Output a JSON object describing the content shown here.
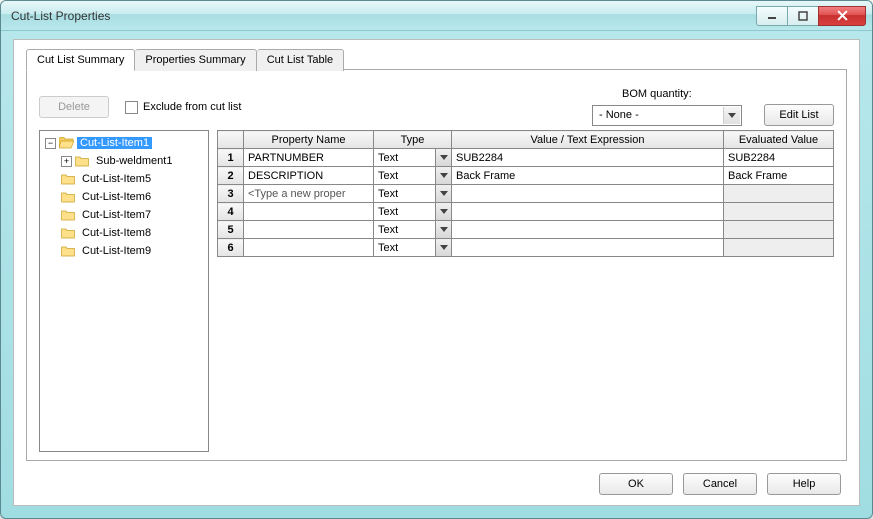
{
  "window": {
    "title": "Cut-List Properties"
  },
  "tabs": [
    {
      "label": "Cut List Summary",
      "active": true
    },
    {
      "label": "Properties Summary",
      "active": false
    },
    {
      "label": "Cut List Table",
      "active": false
    }
  ],
  "toolbar": {
    "delete_label": "Delete",
    "exclude_label": "Exclude from cut list",
    "bom_label": "BOM quantity:",
    "bom_value": "- None -",
    "edit_list_label": "Edit List"
  },
  "tree": {
    "root": {
      "label": "Cut-List-Item1",
      "selected": true,
      "open": true,
      "children": [
        {
          "label": "Sub-weldment1",
          "expandable": true
        }
      ]
    },
    "siblings": [
      {
        "label": "Cut-List-Item5"
      },
      {
        "label": "Cut-List-Item6"
      },
      {
        "label": "Cut-List-Item7"
      },
      {
        "label": "Cut-List-Item8"
      },
      {
        "label": "Cut-List-Item9"
      }
    ]
  },
  "grid": {
    "headers": {
      "propname": "Property Name",
      "type": "Type",
      "value": "Value / Text Expression",
      "evaluated": "Evaluated Value"
    },
    "type_default": "Text",
    "placeholder": "<Type a new proper",
    "rows": [
      {
        "n": "1",
        "name": "PARTNUMBER",
        "type": "Text",
        "value": "SUB2284",
        "evaluated": "SUB2284"
      },
      {
        "n": "2",
        "name": "DESCRIPTION",
        "type": "Text",
        "value": "Back Frame",
        "evaluated": "Back Frame"
      },
      {
        "n": "3",
        "name": "",
        "type": "Text",
        "value": "",
        "evaluated": ""
      },
      {
        "n": "4",
        "name": "",
        "type": "Text",
        "value": "",
        "evaluated": ""
      },
      {
        "n": "5",
        "name": "",
        "type": "Text",
        "value": "",
        "evaluated": ""
      },
      {
        "n": "6",
        "name": "",
        "type": "Text",
        "value": "",
        "evaluated": ""
      }
    ]
  },
  "buttons": {
    "ok": "OK",
    "cancel": "Cancel",
    "help": "Help"
  }
}
